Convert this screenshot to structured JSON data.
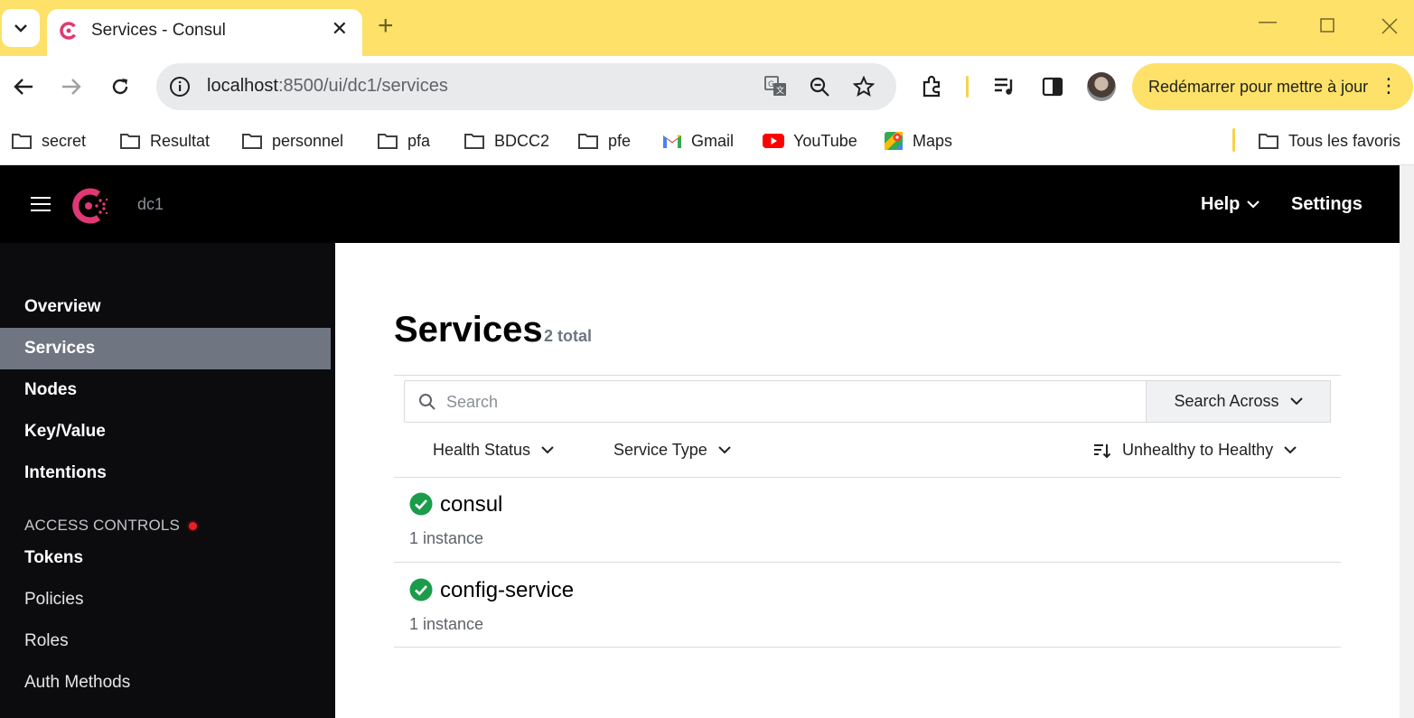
{
  "browser": {
    "tab_title": "Services - Consul",
    "url_host": "localhost",
    "url_rest": ":8500/ui/dc1/services",
    "update_button": "Redémarrer pour mettre à jour",
    "bookmarks": [
      "secret",
      "Resultat",
      "personnel",
      "pfa",
      "BDCC2",
      "pfe",
      "Gmail",
      "YouTube",
      "Maps"
    ],
    "all_bookmarks": "Tous les favoris"
  },
  "header": {
    "datacenter": "dc1",
    "help": "Help",
    "settings": "Settings"
  },
  "sidebar": {
    "items": [
      "Overview",
      "Services",
      "Nodes",
      "Key/Value",
      "Intentions"
    ],
    "active": "Services",
    "section_title": "ACCESS CONTROLS",
    "access_items": [
      "Tokens",
      "Policies",
      "Roles",
      "Auth Methods"
    ]
  },
  "main": {
    "title": "Services",
    "count": "2 total",
    "search": {
      "placeholder": "Search",
      "value": ""
    },
    "search_across": "Search Across",
    "filters": {
      "health_status": "Health Status",
      "service_type": "Service Type",
      "sort": "Unhealthy to Healthy"
    },
    "services": [
      {
        "name": "consul",
        "instances": "1 instance",
        "status": "passing"
      },
      {
        "name": "config-service",
        "instances": "1 instance",
        "status": "passing"
      }
    ]
  },
  "colors": {
    "consul_brand": "#e03875",
    "health_passing": "#1b9c4a",
    "tabbar": "#fde169",
    "active_nav": "#6f7682"
  }
}
